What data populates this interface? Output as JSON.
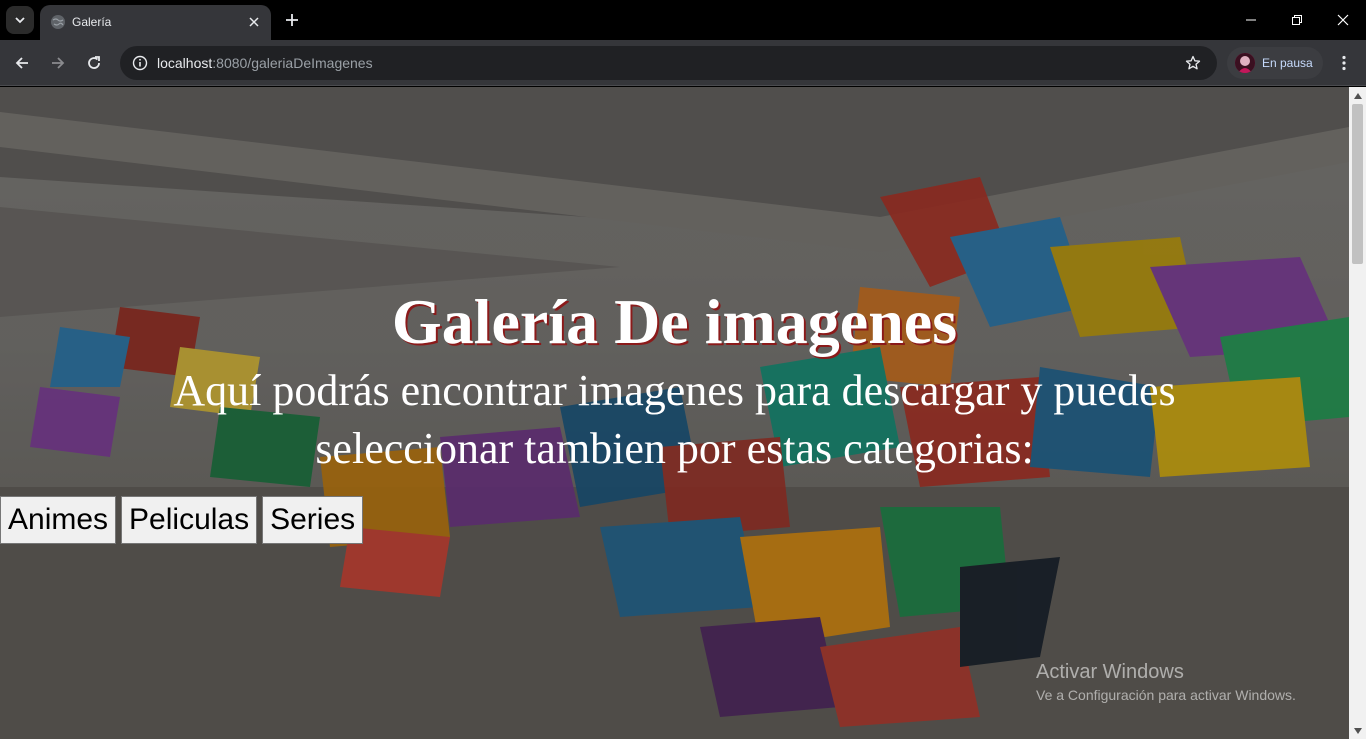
{
  "browser": {
    "tab": {
      "title": "Galería",
      "favicon": "globe-icon"
    },
    "address": {
      "host": "localhost",
      "rest": ":8080/galeriaDeImagenes"
    },
    "profile": {
      "label": "En pausa"
    }
  },
  "page": {
    "title": "Galería De imagenes",
    "subtitle": "Aquí podrás encontrar imagenes para descargar y puedes seleccionar tambien por estas categorias:",
    "categories": [
      "Animes",
      "Peliculas",
      "Series"
    ]
  },
  "os": {
    "watermark_title": "Activar Windows",
    "watermark_sub": "Ve a Configuración para activar Windows."
  },
  "colors": {
    "chrome_bg": "#35363a",
    "tab_strip": "#000000",
    "title_shadow": "#8b1a1a"
  }
}
